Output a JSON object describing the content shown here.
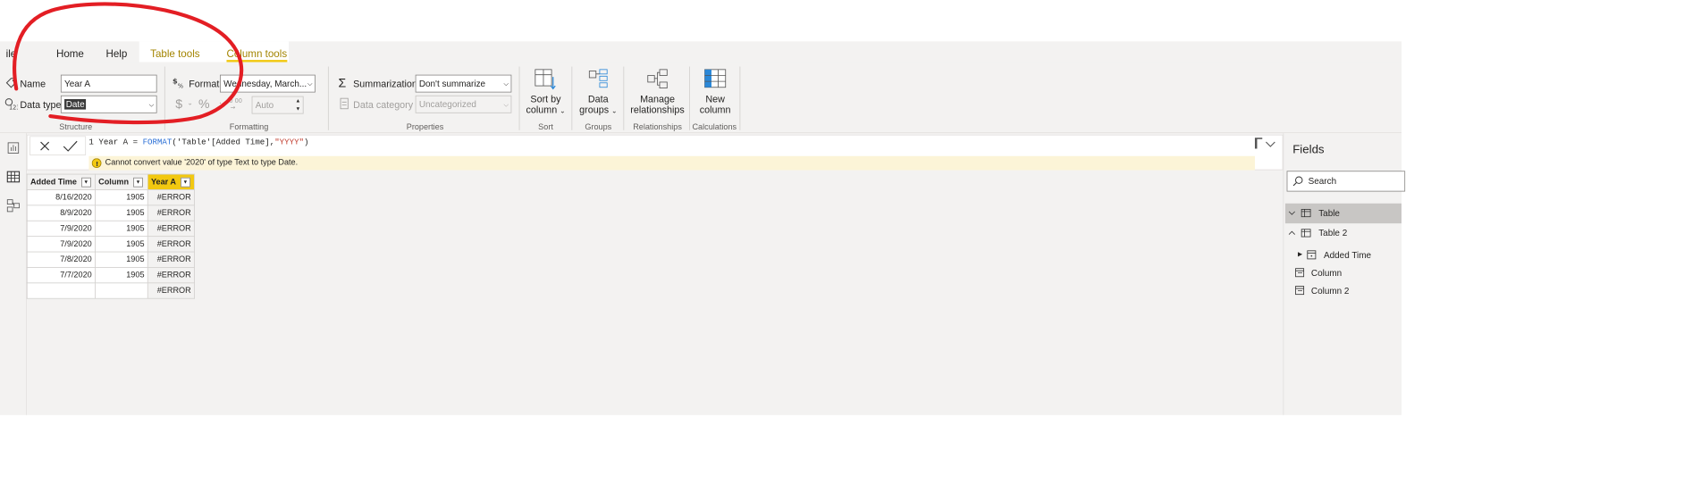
{
  "tabs": {
    "file": "ile",
    "home": "Home",
    "help": "Help",
    "table_tools": "Table tools",
    "column_tools": "Column tools"
  },
  "structure": {
    "name_label": "Name",
    "name_value": "Year A",
    "datatype_label": "Data type",
    "datatype_value": "Date",
    "group_label": "Structure"
  },
  "formatting": {
    "format_label": "Format",
    "format_value": "Wednesday, March...",
    "currency": "$",
    "percent": "%",
    "decimal_value": "Auto",
    "group_label": "Formatting"
  },
  "properties": {
    "summarization_label": "Summarization",
    "summarization_value": "Don't summarize",
    "category_label": "Data category",
    "category_value": "Uncategorized",
    "group_label": "Properties"
  },
  "sort": {
    "line1": "Sort by",
    "line2": "column",
    "group_label": "Sort"
  },
  "groups": {
    "line1": "Data",
    "line2": "groups",
    "group_label": "Groups"
  },
  "relationships": {
    "line1": "Manage",
    "line2": "relationships",
    "group_label": "Relationships"
  },
  "calculations": {
    "line1": "New",
    "line2": "column",
    "group_label": "Calculations"
  },
  "formula": {
    "line_no": "1",
    "prefix": "Year A = ",
    "func": "FORMAT",
    "open": "(",
    "arg1": "'Table'[Added Time],",
    "arg2": "\"YYYY\"",
    "close": ")",
    "error": "Cannot convert value '2020' of type Text to type Date."
  },
  "grid": {
    "headers": [
      "Added Time",
      "Column",
      "Year A"
    ],
    "rows": [
      [
        "8/16/2020",
        "1905",
        "#ERROR"
      ],
      [
        "8/9/2020",
        "1905",
        "#ERROR"
      ],
      [
        "7/9/2020",
        "1905",
        "#ERROR"
      ],
      [
        "7/9/2020",
        "1905",
        "#ERROR"
      ],
      [
        "7/8/2020",
        "1905",
        "#ERROR"
      ],
      [
        "7/7/2020",
        "1905",
        "#ERROR"
      ],
      [
        "",
        "",
        "#ERROR"
      ]
    ]
  },
  "fields_pane": {
    "title": "Fields",
    "search_placeholder": "Search",
    "items": [
      "Table",
      "Table 2",
      "Added Time",
      "Column",
      "Column 2"
    ]
  },
  "colors": {
    "accent": "#f2c811",
    "annotation": "#e31e24",
    "ribbon_bg": "#f3f2f1"
  }
}
